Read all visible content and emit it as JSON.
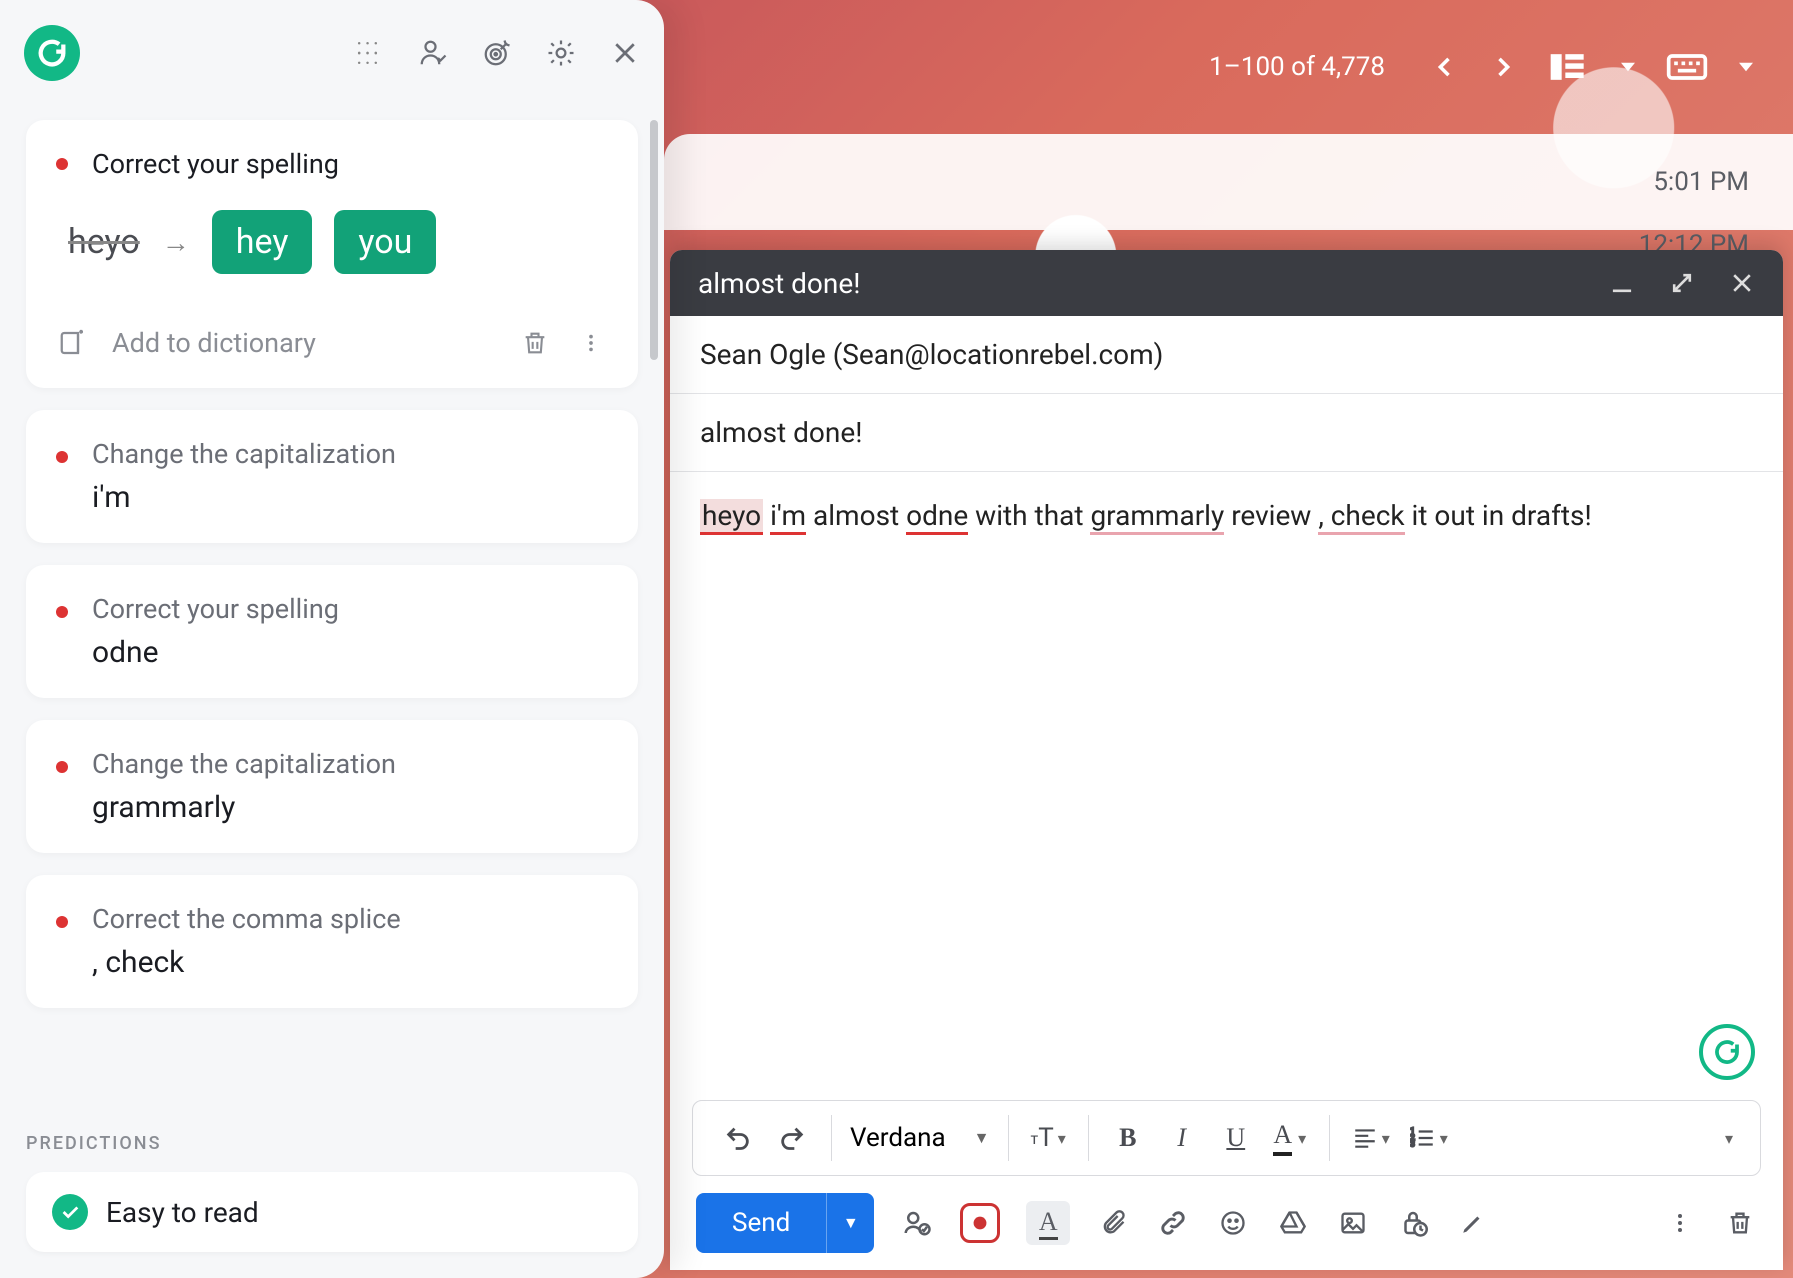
{
  "gmail_top": {
    "count_text": "1–100 of 4,778"
  },
  "inbox": {
    "time1": "5:01 PM",
    "time2": "12:12 PM"
  },
  "compose": {
    "subject_header": "almost done!",
    "to": "Sean Ogle (Sean@locationrebel.com)",
    "subject": "almost done!",
    "body_parts": {
      "w1": "heyo",
      "w2": "i'm",
      "t1": " almost ",
      "w3": "odne",
      "t2": " with that ",
      "w4": "grammarly",
      "t3": " review",
      "w5": ", check",
      "t4": " it out in drafts!"
    },
    "font_name": "Verdana",
    "send_label": "Send"
  },
  "grammarly": {
    "expanded": {
      "title": "Correct your spelling",
      "original": "heyo",
      "suggestions": [
        "hey",
        "you"
      ],
      "add_dict": "Add to dictionary"
    },
    "cards": [
      {
        "title": "Change the capitalization",
        "word": "i'm"
      },
      {
        "title": "Correct your spelling",
        "word": "odne"
      },
      {
        "title": "Change the capitalization",
        "word": "grammarly"
      },
      {
        "title": "Correct the comma splice",
        "word": ", check"
      }
    ],
    "predictions_label": "PREDICTIONS",
    "prediction": "Easy to read"
  }
}
